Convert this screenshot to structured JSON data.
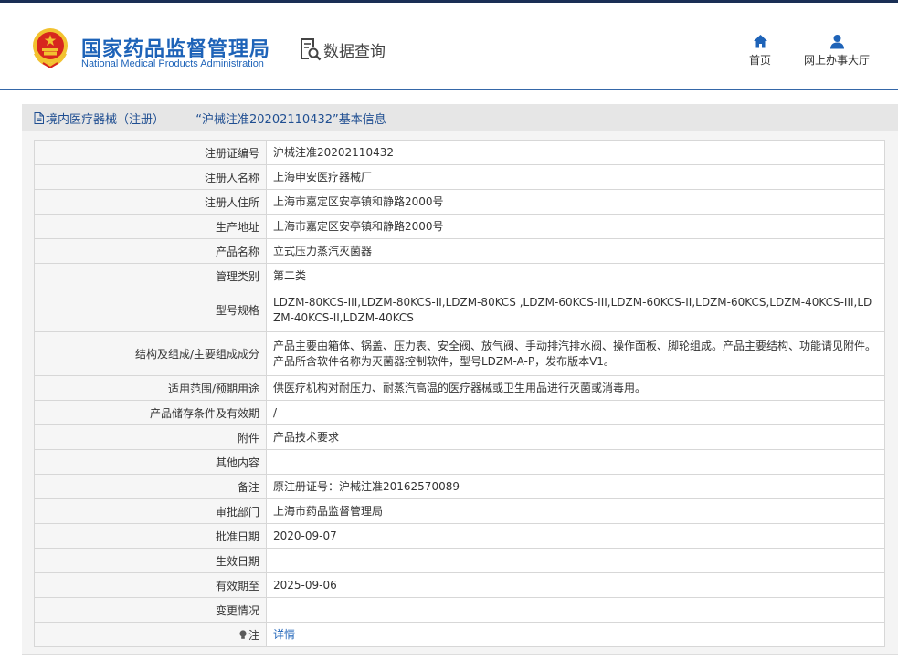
{
  "header": {
    "site_title_cn": "国家药品监督管理局",
    "site_title_en": "National Medical Products Administration",
    "data_query_label": "数据查询",
    "nav": [
      {
        "label": "首页",
        "icon": "home-icon"
      },
      {
        "label": "网上办事大厅",
        "icon": "user-icon"
      }
    ]
  },
  "breadcrumb": {
    "text": "境内医疗器械（注册） —— “沪械注准20202110432”基本信息"
  },
  "details": [
    {
      "label": "注册证编号",
      "value": "沪械注准20202110432"
    },
    {
      "label": "注册人名称",
      "value": "上海申安医疗器械厂"
    },
    {
      "label": "注册人住所",
      "value": "上海市嘉定区安亭镇和静路2000号"
    },
    {
      "label": "生产地址",
      "value": "上海市嘉定区安亭镇和静路2000号"
    },
    {
      "label": "产品名称",
      "value": "立式压力蒸汽灭菌器"
    },
    {
      "label": "管理类别",
      "value": "第二类"
    },
    {
      "label": "型号规格",
      "value": "LDZM-80KCS-III,LDZM-80KCS-II,LDZM-80KCS ,LDZM-60KCS-III,LDZM-60KCS-II,LDZM-60KCS,LDZM-40KCS-III,LDZM-40KCS-II,LDZM-40KCS"
    },
    {
      "label": "结构及组成/主要组成成分",
      "value": "产品主要由箱体、锅盖、压力表、安全阀、放气阀、手动排汽排水阀、操作面板、脚轮组成。产品主要结构、功能请见附件。产品所含软件名称为灭菌器控制软件，型号LDZM-A-P，发布版本V1。"
    },
    {
      "label": "适用范围/预期用途",
      "value": "供医疗机构对耐压力、耐蒸汽高温的医疗器械或卫生用品进行灭菌或消毒用。"
    },
    {
      "label": "产品储存条件及有效期",
      "value": "/"
    },
    {
      "label": "附件",
      "value": "产品技术要求"
    },
    {
      "label": "其他内容",
      "value": ""
    },
    {
      "label": "备注",
      "value": "原注册证号：沪械注准20162570089"
    },
    {
      "label": "审批部门",
      "value": "上海市药品监督管理局"
    },
    {
      "label": "批准日期",
      "value": "2020-09-07"
    },
    {
      "label": "生效日期",
      "value": ""
    },
    {
      "label": "有效期至",
      "value": "2025-09-06"
    },
    {
      "label": "变更情况",
      "value": ""
    }
  ],
  "note_row": {
    "label": "注",
    "icon": "lightbulb-icon",
    "link_text": "详情"
  },
  "colors": {
    "brand_blue": "#1e63b8",
    "header_rule": "#3567a8",
    "top_line": "#1a2f55",
    "crumb_bg": "#e6e6e6",
    "emblem_red": "#d7261e",
    "emblem_gold": "#f2c230"
  }
}
